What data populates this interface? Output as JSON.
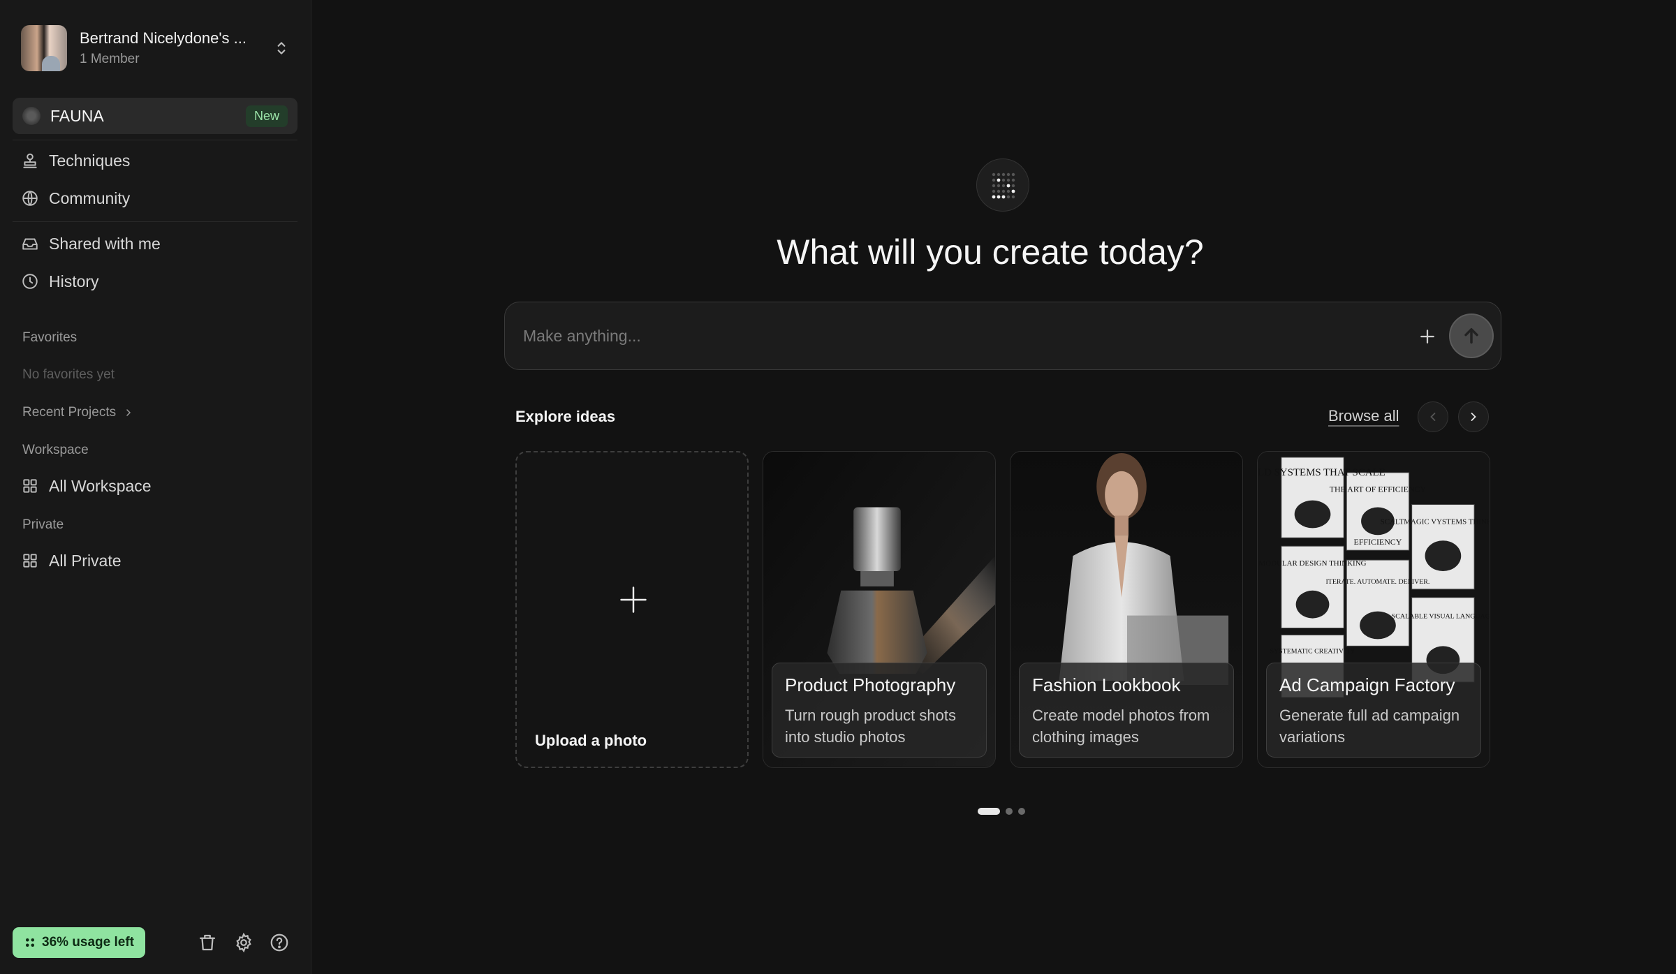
{
  "account": {
    "name": "Bertrand Nicelydone's ...",
    "members": "1 Member"
  },
  "fauna": {
    "label": "FAUNA",
    "badge": "New"
  },
  "nav": {
    "techniques": "Techniques",
    "community": "Community",
    "shared": "Shared with me",
    "history": "History"
  },
  "favorites": {
    "label": "Favorites",
    "empty": "No favorites yet"
  },
  "recent_projects": "Recent Projects",
  "workspace": {
    "label": "Workspace",
    "all": "All Workspace"
  },
  "private": {
    "label": "Private",
    "all": "All Private"
  },
  "usage": {
    "label": "36% usage left",
    "accent": "#8fe3a0"
  },
  "main": {
    "headline": "What will you create today?",
    "prompt_placeholder": "Make anything...",
    "explore_title": "Explore ideas",
    "browse_all": "Browse all"
  },
  "cards": [
    {
      "title": "Upload a photo"
    },
    {
      "title": "Product Photography",
      "desc": "Turn rough product shots into studio photos"
    },
    {
      "title": "Fashion Lookbook",
      "desc": "Create model photos from clothing images"
    },
    {
      "title": "Ad Campaign Factory",
      "desc": "Generate full ad campaign variations"
    }
  ],
  "ad_posters": [
    "BUILD SYSTEMS THAT SCALE",
    "THE ART OF EFFICIENCY",
    "EFFICIENCY",
    "SCALTMAGIC VYSTEMS THINKING",
    "MODULAR DESIGN THINKING",
    "ITERATE. AUTOMATE. DELIVER.",
    "SCALABLE VISUAL LANGUAGE",
    "SYSTEMATIC CREATIVITY"
  ],
  "pagination": {
    "pages": 3,
    "current": 1
  }
}
